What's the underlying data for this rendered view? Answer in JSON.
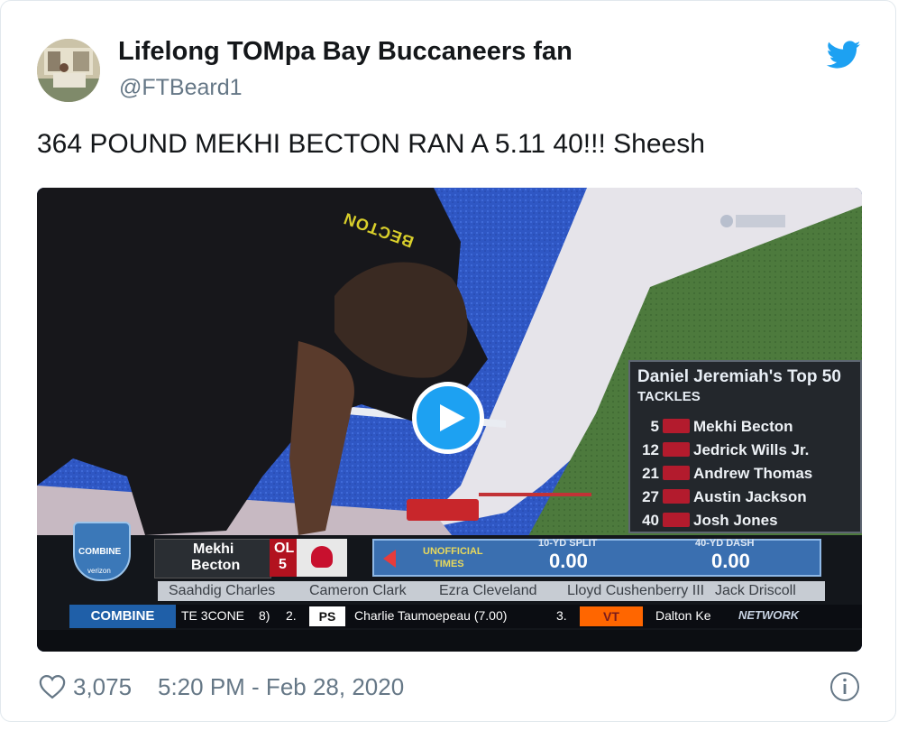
{
  "author": {
    "display_name": "Lifelong TOMpa Bay Buccaneers fan",
    "handle": "@FTBeard1"
  },
  "tweet": {
    "text": "364 POUND MEKHI BECTON RAN A 5.11 40!!! Sheesh",
    "likes": "3,075",
    "timestamp": "5:20 PM - Feb 28, 2020"
  },
  "icons": {
    "brand": "twitter-bird-icon",
    "like": "heart-icon",
    "info": "info-icon",
    "play": "play-icon"
  },
  "colors": {
    "twitter_blue": "#1da1f2",
    "text_primary": "#14171a",
    "text_secondary": "#657786"
  },
  "video": {
    "jersey_text": "BECTON",
    "panel": {
      "title": "Daniel Jeremiah's Top 50",
      "subtitle": "TACKLES",
      "rows": [
        {
          "rank": "5",
          "name": "Mekhi Becton"
        },
        {
          "rank": "12",
          "name": "Jedrick Wills Jr."
        },
        {
          "rank": "21",
          "name": "Andrew Thomas"
        },
        {
          "rank": "27",
          "name": "Austin Jackson"
        },
        {
          "rank": "40",
          "name": "Josh Jones"
        }
      ]
    },
    "lower_third": {
      "player_first": "Mekhi",
      "player_last": "Becton",
      "position": "OL",
      "number": "5",
      "unofficial_label": "UNOFFICIAL",
      "times_label": "TIMES",
      "split_label": "10-YD SPLIT",
      "split_value": "0.00",
      "dash_label": "40-YD DASH",
      "dash_value": "0.00",
      "combine_badge": "COMBINE",
      "sponsor": "verizon"
    },
    "names_row": [
      "Saahdig Charles",
      "Cameron Clark",
      "Ezra Cleveland",
      "Lloyd Cushenberry III",
      "Jack Driscoll"
    ],
    "ticker": {
      "label": "COMBINE",
      "item1": "TE 3CONE",
      "item1_tail": "8)",
      "num2": "2.",
      "logo2": "PS",
      "item2": "Charlie Taumoepeau (7.00)",
      "num3": "3.",
      "logo3": "VT",
      "item3": "Dalton Ke",
      "network": "NETWORK"
    }
  }
}
